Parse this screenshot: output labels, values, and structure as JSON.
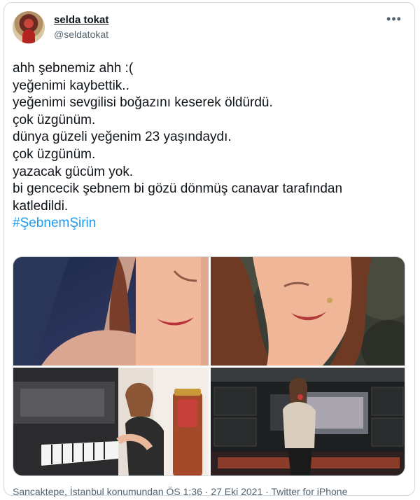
{
  "user": {
    "display_name": "selda tokat",
    "handle": "@seldatokat"
  },
  "menu": {
    "more_label": "•••"
  },
  "tweet": {
    "lines": [
      "ahh şebnemiz ahh :(",
      "yeğenimi kaybettik..",
      "yeğenimi sevgilisi boğazını keserek öldürdü.",
      "çok üzgünüm.",
      "dünya güzeli yeğenim 23 yaşındaydı.",
      "çok üzgünüm.",
      "yazacak gücüm yok.",
      "bi gencecik şebnem bi gözü dönmüş canavar tarafından",
      "katledildi."
    ],
    "hashtag": "#ŞebnemŞirin"
  },
  "media": {
    "photos": [
      {
        "icon": "selfie-photo"
      },
      {
        "icon": "selfie-photo"
      },
      {
        "icon": "piano-photo"
      },
      {
        "icon": "living-room-photo"
      }
    ]
  },
  "footer": {
    "meta": "Sancaktepe, İstanbul konumundan ÖS 1:36 · 27 Eki 2021 · Twitter for iPhone"
  },
  "colors": {
    "link": "#1d9bf0",
    "secondary_text": "#536471",
    "border": "#cfd9de"
  }
}
